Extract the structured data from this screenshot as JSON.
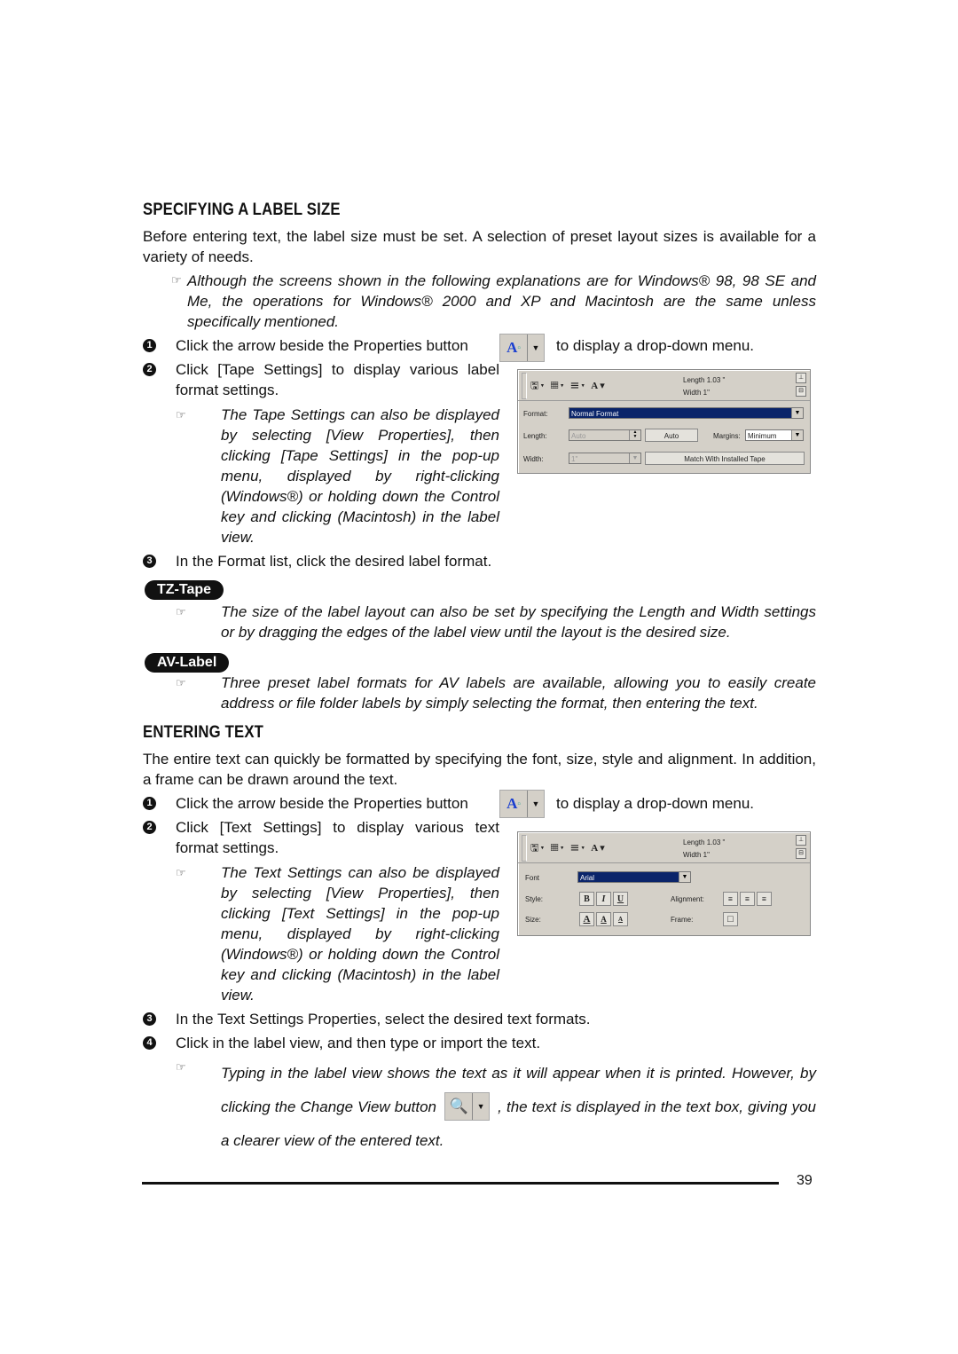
{
  "section1": {
    "heading": "SPECIFYING A LABEL SIZE",
    "intro": "Before entering text, the label size must be set. A selection of preset layout sizes is available for a variety of needs.",
    "note": "Although the screens shown in the following explanations are for Windows® 98, 98 SE and Me, the operations for Windows® 2000 and XP and Macintosh are the same unless specifically mentioned.",
    "steps": [
      {
        "num": "1",
        "text_before": "Click the arrow beside the Properties button",
        "text_after": "to display a drop-down menu."
      },
      {
        "num": "2",
        "text": "Click [Tape Settings] to display various label format settings."
      },
      {
        "num": "3",
        "text": "In the Format list, click the desired label format."
      }
    ],
    "step2_note": "The Tape Settings can also be displayed by selecting [View Properties], then clicking [Tape Settings] in the pop-up menu, displayed by right-clicking (Windows®) or holding down the Control key and clicking (Macintosh) in the label view.",
    "tz_badge": "TZ-Tape",
    "tz_note": "The size of the label layout can also be set by specifying the Length and Width settings or by dragging the edges of the label view until the layout is the desired size.",
    "av_badge": "AV-Label",
    "av_note": "Three preset label formats for AV labels are available, allowing you to easily create address or file folder labels by simply selecting the format, then entering the text."
  },
  "tape_panel": {
    "length_readout": "Length 1.03 \"",
    "width_readout": "Width 1\"",
    "format_label": "Format:",
    "format_value": "Normal Format",
    "length_label": "Length:",
    "length_value": "Auto",
    "auto_button": "Auto",
    "margins_label": "Margins:",
    "margins_value": "Minimum",
    "width_label": "Width:",
    "width_value": "1\"",
    "match_button": "Match With Installed Tape"
  },
  "section2": {
    "heading": "ENTERING TEXT",
    "intro": "The entire text can quickly be formatted by specifying the font, size, style and alignment. In addition, a frame can be drawn around the text.",
    "steps": [
      {
        "num": "1",
        "text_before": "Click the arrow beside the Properties button",
        "text_after": "to display a drop-down menu."
      },
      {
        "num": "2",
        "text": "Click [Text Settings] to display various text format settings."
      },
      {
        "num": "3",
        "text": "In the Text Settings Properties, select the desired text formats."
      },
      {
        "num": "4",
        "text": "Click in the label view, and then type or import the text."
      }
    ],
    "step2_note": "The Text Settings can also be displayed by selecting [View Properties], then clicking [Text Settings] in the pop-up menu, displayed by right-clicking (Windows®) or holding down the Control key and clicking (Macintosh) in the label view.",
    "step4_note_1": "Typing in the label view shows the text as it will appear when it is printed. However, by clicking the Change View button",
    "step4_note_2": ", the text is displayed in the text box, giving you a clearer view of the entered text."
  },
  "text_panel": {
    "length_readout": "Length 1.03 \"",
    "width_readout": "Width 1\"",
    "font_label": "Font",
    "font_value": "Arial",
    "style_label": "Style:",
    "style_buttons": [
      "B",
      "I",
      "U"
    ],
    "alignment_label": "Alignment:",
    "size_label": "Size:",
    "frame_label": "Frame:"
  },
  "footer": {
    "page_number": "39"
  },
  "icons": {
    "hand": "☞",
    "dropdown": "▼"
  }
}
